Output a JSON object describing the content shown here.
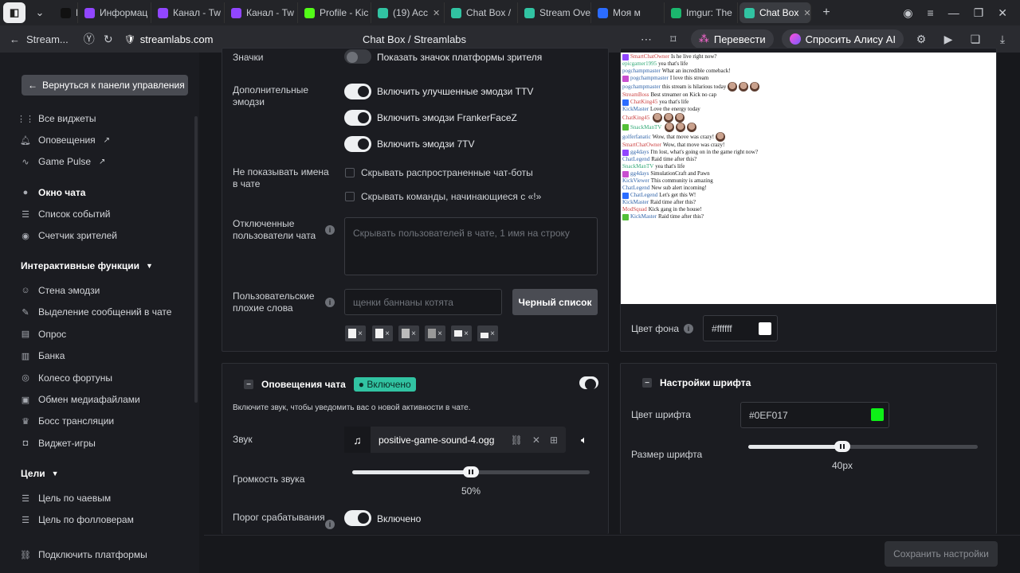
{
  "browser": {
    "tabs": [
      {
        "label": "D",
        "icon": "dzen-icon",
        "color": "#111111"
      },
      {
        "label": "Информац",
        "icon": "twitch-icon",
        "color": "#9146ff"
      },
      {
        "label": "Канал - Tw",
        "icon": "twitch-icon",
        "color": "#9146ff"
      },
      {
        "label": "Канал - Tw",
        "icon": "twitch-icon",
        "color": "#9146ff"
      },
      {
        "label": "Profile - Kic",
        "icon": "kick-icon",
        "color": "#53fc18"
      },
      {
        "label": "(19) Acc",
        "icon": "streamlabs-icon",
        "color": "#31c3a2"
      },
      {
        "label": "Chat Box /",
        "icon": "streamlabs-icon",
        "color": "#31c3a2"
      },
      {
        "label": "Stream Ove",
        "icon": "streamlabs-icon",
        "color": "#31c3a2"
      },
      {
        "label": "Моя м",
        "icon": "youtube-icon",
        "color": "#2b6cff"
      },
      {
        "label": "Imgur: The",
        "icon": "imgur-icon",
        "color": "#1bb76e"
      },
      {
        "label": "Chat Box",
        "icon": "streamlabs-icon",
        "color": "#31c3a2"
      }
    ],
    "back_site": "Stream...",
    "url": "streamlabs.com",
    "page_title": "Chat Box / Streamlabs",
    "translate": "Перевести",
    "ask_alice": "Спросить Алису AI"
  },
  "sidebar": {
    "back_button": "Вернуться к панели управления",
    "items_top": [
      {
        "label": "Все виджеты",
        "icon": "grid-icon"
      },
      {
        "label": "Оповещения",
        "icon": "bell-icon",
        "external": true
      },
      {
        "label": "Game Pulse",
        "icon": "pulse-icon",
        "external": true
      }
    ],
    "items_main": [
      {
        "label": "Окно чата",
        "icon": "chat-icon",
        "active": true
      },
      {
        "label": "Список событий",
        "icon": "list-icon"
      },
      {
        "label": "Счетчик зрителей",
        "icon": "eye-icon"
      }
    ],
    "section_interactive": "Интерактивные функции",
    "items_interactive": [
      {
        "label": "Стена эмодзи",
        "icon": "emoji-icon"
      },
      {
        "label": "Выделение сообщений в чате",
        "icon": "pen-icon"
      },
      {
        "label": "Опрос",
        "icon": "poll-icon"
      },
      {
        "label": "Банка",
        "icon": "jar-icon"
      },
      {
        "label": "Колесо фортуны",
        "icon": "wheel-icon"
      },
      {
        "label": "Обмен медиафайлами",
        "icon": "media-icon"
      },
      {
        "label": "Босс трансляции",
        "icon": "boss-icon"
      },
      {
        "label": "Виджет-игры",
        "icon": "gamepad-icon"
      }
    ],
    "section_goals": "Цели",
    "items_goals": [
      {
        "label": "Цель по чаевым",
        "icon": "tip-icon"
      },
      {
        "label": "Цель по фолловерам",
        "icon": "follower-icon"
      }
    ],
    "connect": "Подключить платформы"
  },
  "settings": {
    "badges_label": "Значки",
    "badges_toggle": "Показать значок платформы зрителя",
    "extra_emotes_label": "Дополнительные эмодзи",
    "emote_toggles": [
      "Включить улучшенные эмодзи TTV",
      "Включить эмодзи FrankerFaceZ",
      "Включить эмодзи 7TV"
    ],
    "hide_names_label": "Не показывать имена в чате",
    "hide_checks": [
      "Скрывать распространенные чат-боты",
      "Скрывать команды, начинающиеся с «!»"
    ],
    "muted_users_label": "Отключенные пользователи чата",
    "muted_users_placeholder": "Скрывать пользователей в чате, 1 имя на строку",
    "bad_words_label": "Пользовательские плохие слова",
    "bad_words_placeholder": "щенки баннаны котята",
    "blacklist_button": "Черный список",
    "bg_color_label": "Цвет фона",
    "bg_color_value": "#ffffff"
  },
  "alerts": {
    "title": "Оповещения чата",
    "status": "Включено",
    "desc": "Включите звук, чтобы уведомить вас о новой активности в чате.",
    "sound_label": "Звук",
    "sound_file": "positive-game-sound-4.ogg",
    "volume_label": "Громкость звука",
    "volume_value": "50%",
    "volume_fraction": 0.5,
    "threshold_label": "Порог срабатывания",
    "threshold_value": "Включено"
  },
  "font": {
    "title": "Настройки шрифта",
    "color_label": "Цвет шрифта",
    "color_value": "#0EF017",
    "size_label": "Размер шрифта",
    "size_value": "40px",
    "size_fraction": 0.41
  },
  "preview_chat": [
    {
      "name": "SmartChatOwner",
      "text": "Is he live right now?",
      "color": "#c44"
    },
    {
      "name": "epicgamer1995",
      "text": "yea that's life",
      "color": "#3a7"
    },
    {
      "name": "pogchampmaster",
      "text": "What an incredible comeback!",
      "color": "#36a"
    },
    {
      "name": "pogchampmaster",
      "text": "I love this stream",
      "color": "#36a"
    },
    {
      "name": "pogchampmaster",
      "text": "this stream is hilarious today",
      "color": "#36a"
    },
    {
      "name": "StreamBoss",
      "text": "Best streamer on Kick no cap",
      "color": "#c44"
    },
    {
      "name": "ChatKing45",
      "text": "yea that's life",
      "color": "#c44"
    },
    {
      "name": "KickMaster",
      "text": "Love the energy today",
      "color": "#36a"
    },
    {
      "name": "ChatKing45",
      "text": "",
      "color": "#c44"
    },
    {
      "name": "SnackManTV",
      "text": "",
      "color": "#3a7"
    },
    {
      "name": "golferfanatic",
      "text": "Wow, that move was crazy!",
      "color": "#36a"
    },
    {
      "name": "SmartChatOwner",
      "text": "Wow, that move was crazy!",
      "color": "#c44"
    },
    {
      "name": "gg4days",
      "text": "I'm lost, what's going on in the game right now?",
      "color": "#36a"
    },
    {
      "name": "ChatLegend",
      "text": "Raid time after this?",
      "color": "#36a"
    },
    {
      "name": "SnackManTV",
      "text": "yea that's life",
      "color": "#3a7"
    },
    {
      "name": "gg4days",
      "text": "SimulationCraft and Pawn",
      "color": "#36a"
    },
    {
      "name": "KickViewer",
      "text": "This community is amazing",
      "color": "#36a"
    },
    {
      "name": "ChatLegend",
      "text": "New sub alert incoming!",
      "color": "#36a"
    },
    {
      "name": "ChatLegend",
      "text": "Let's get this W!",
      "color": "#36a"
    },
    {
      "name": "KickMaster",
      "text": "Raid time after this?",
      "color": "#36a"
    },
    {
      "name": "ModSquad",
      "text": "Kick gang in the house!",
      "color": "#c44"
    },
    {
      "name": "KickMaster",
      "text": "Raid time after this?",
      "color": "#36a"
    }
  ],
  "save_button": "Сохранить настройки",
  "colors": {
    "accent": "#31c3a2",
    "font_color": "#0EF017"
  }
}
